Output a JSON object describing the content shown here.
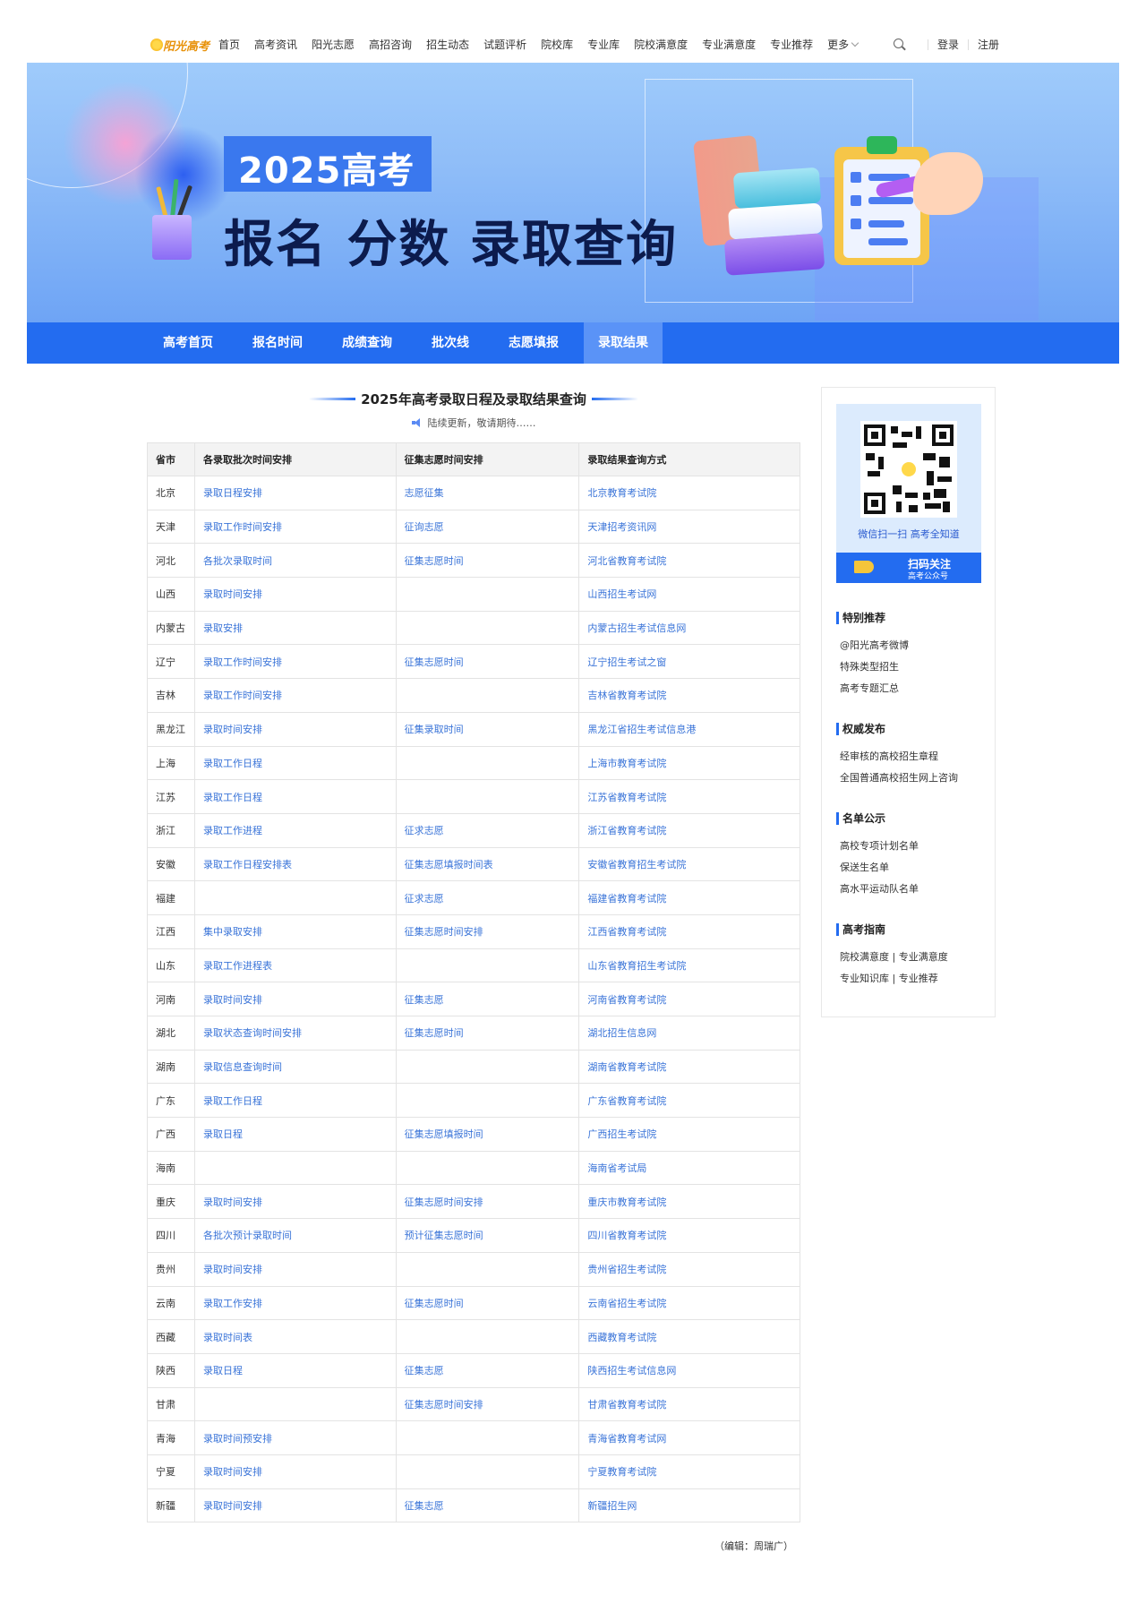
{
  "header": {
    "logo_text": "阳光高考",
    "nav": [
      "首页",
      "高考资讯",
      "阳光志愿",
      "高招咨询",
      "招生动态",
      "试题评析",
      "院校库",
      "专业库",
      "院校满意度",
      "专业满意度",
      "专业推荐",
      "更多"
    ],
    "login": "登录",
    "register": "注册",
    "icons": {
      "search": "search-icon",
      "more": "chevron-down-icon"
    }
  },
  "banner": {
    "year_text": "2025高考",
    "slogan": "报名 分数 录取查询"
  },
  "subnav": {
    "items": [
      "高考首页",
      "报名时间",
      "成绩查询",
      "批次线",
      "志愿填报",
      "录取结果"
    ],
    "active": "录取结果"
  },
  "main": {
    "title": "2025年高考录取日程及录取结果查询",
    "subtitle": "陆续更新，敬请期待……",
    "table": {
      "headers": [
        "省市",
        "各录取批次时间安排",
        "征集志愿时间安排",
        "录取结果查询方式"
      ],
      "rows": [
        [
          "北京",
          "录取日程安排",
          "志愿征集",
          "北京教育考试院"
        ],
        [
          "天津",
          "录取工作时间安排",
          "征询志愿",
          "天津招考资讯网"
        ],
        [
          "河北",
          "各批次录取时间",
          "征集志愿时间",
          "河北省教育考试院"
        ],
        [
          "山西",
          "录取时间安排",
          "",
          "山西招生考试网"
        ],
        [
          "内蒙古",
          "录取安排",
          "",
          "内蒙古招生考试信息网"
        ],
        [
          "辽宁",
          "录取工作时间安排",
          "征集志愿时间",
          "辽宁招生考试之窗"
        ],
        [
          "吉林",
          "录取工作时间安排",
          "",
          "吉林省教育考试院"
        ],
        [
          "黑龙江",
          "录取时间安排",
          "征集录取时间",
          "黑龙江省招生考试信息港"
        ],
        [
          "上海",
          "录取工作日程",
          "",
          "上海市教育考试院"
        ],
        [
          "江苏",
          "录取工作日程",
          "",
          "江苏省教育考试院"
        ],
        [
          "浙江",
          "录取工作进程",
          "征求志愿",
          "浙江省教育考试院"
        ],
        [
          "安徽",
          "录取工作日程安排表",
          "征集志愿填报时间表",
          "安徽省教育招生考试院"
        ],
        [
          "福建",
          "",
          "征求志愿",
          "福建省教育考试院"
        ],
        [
          "江西",
          "集中录取安排",
          "征集志愿时间安排",
          "江西省教育考试院"
        ],
        [
          "山东",
          "录取工作进程表",
          "",
          "山东省教育招生考试院"
        ],
        [
          "河南",
          "录取时间安排",
          "征集志愿",
          "河南省教育考试院"
        ],
        [
          "湖北",
          "录取状态查询时间安排",
          "征集志愿时间",
          "湖北招生信息网"
        ],
        [
          "湖南",
          "录取信息查询时间",
          "",
          "湖南省教育考试院"
        ],
        [
          "广东",
          "录取工作日程",
          "",
          "广东省教育考试院"
        ],
        [
          "广西",
          "录取日程",
          "征集志愿填报时间",
          "广西招生考试院"
        ],
        [
          "海南",
          "",
          "",
          "海南省考试局"
        ],
        [
          "重庆",
          "录取时间安排",
          "征集志愿时间安排",
          "重庆市教育考试院"
        ],
        [
          "四川",
          "各批次预计录取时间",
          "预计征集志愿时间",
          "四川省教育考试院"
        ],
        [
          "贵州",
          "录取时间安排",
          "",
          "贵州省招生考试院"
        ],
        [
          "云南",
          "录取工作安排",
          "征集志愿时间",
          "云南省招生考试院"
        ],
        [
          "西藏",
          "录取时间表",
          "",
          "西藏教育考试院"
        ],
        [
          "陕西",
          "录取日程",
          "征集志愿",
          "陕西招生考试信息网"
        ],
        [
          "甘肃",
          "",
          "征集志愿时间安排",
          "甘肃省教育考试院"
        ],
        [
          "青海",
          "录取时间预安排",
          "",
          "青海省教育考试网"
        ],
        [
          "宁夏",
          "录取时间安排",
          "",
          "宁夏教育考试院"
        ],
        [
          "新疆",
          "录取时间安排",
          "征集志愿",
          "新疆招生网"
        ]
      ]
    },
    "editor": "（编辑：周瑞广）"
  },
  "sidebar": {
    "qr_caption": "微信扫一扫  高考全知道",
    "qr_banner_line1": "扫码关注",
    "qr_banner_line2": "高考公众号",
    "sections": [
      {
        "heading": "特别推荐",
        "links": [
          "@阳光高考微博",
          "特殊类型招生",
          "高考专题汇总"
        ]
      },
      {
        "heading": "权威发布",
        "links": [
          "经审核的高校招生章程",
          "全国普通高校招生网上咨询"
        ]
      },
      {
        "heading": "名单公示",
        "links": [
          "高校专项计划名单",
          "保送生名单",
          "高水平运动队名单"
        ]
      },
      {
        "heading": "高考指南",
        "links": [
          "院校满意度 | 专业满意度",
          "专业知识库 | 专业推荐"
        ]
      }
    ]
  },
  "colors": {
    "accent": "#236cf0",
    "link": "#3a74d8",
    "subnav_active": "#5a93f7"
  }
}
